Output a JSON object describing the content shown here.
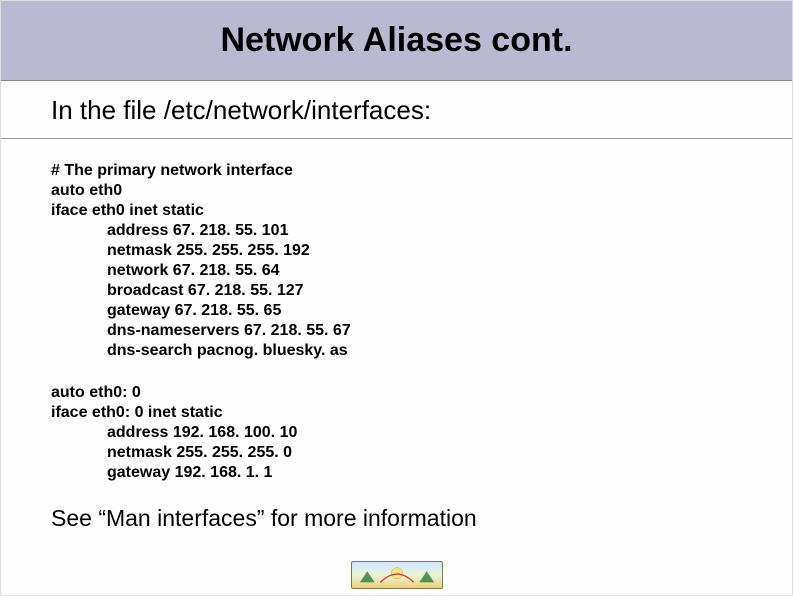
{
  "title": "Network Aliases cont.",
  "subhead": "In the file /etc/network/interfaces:",
  "block1": {
    "comment": "# The primary network interface",
    "auto": "auto eth0",
    "iface": "iface eth0 inet static",
    "lines": [
      "address 67. 218. 55. 101",
      "netmask 255. 255. 255. 192",
      "network 67. 218. 55. 64",
      "broadcast 67. 218. 55. 127",
      "gateway 67. 218. 55. 65",
      "dns-nameservers 67. 218. 55. 67",
      "dns-search pacnog. bluesky. as"
    ]
  },
  "block2": {
    "auto": "auto eth0: 0",
    "iface": "iface eth0: 0 inet static",
    "lines": [
      "address 192. 168. 100. 10",
      "netmask 255. 255. 255. 0",
      "gateway 192. 168. 1. 1"
    ]
  },
  "closing": "See “Man interfaces” for more information"
}
